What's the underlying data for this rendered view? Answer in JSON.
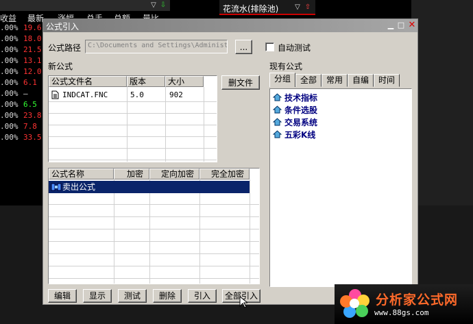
{
  "bg_table": {
    "header": [
      "收益",
      "最新",
      "涨幅",
      "总手",
      "总额",
      "量比"
    ],
    "rows": [
      {
        "a": ".00%",
        "b": "19.6",
        "c": "#ff3333"
      },
      {
        "a": ".00%",
        "b": "18.0",
        "c": "#ff3333"
      },
      {
        "a": ".00%",
        "b": "21.5",
        "c": "#ff3333"
      },
      {
        "a": ".00%",
        "b": "13.1",
        "c": "#ff3333"
      },
      {
        "a": ".00%",
        "b": "12.0",
        "c": "#ff3333"
      },
      {
        "a": ".00%",
        "b": "6.1",
        "c": "#ff3333"
      },
      {
        "a": ".00%",
        "b": "—",
        "c": "#dddddd"
      },
      {
        "a": ".00%",
        "b": "6.5",
        "c": "#33ff33"
      },
      {
        "a": ".00%",
        "b": "23.8",
        "c": "#ff3333"
      },
      {
        "a": ".00%",
        "b": "7.8",
        "c": "#ff3333"
      },
      {
        "a": ".00%",
        "b": "33.5",
        "c": "#ff3333"
      }
    ]
  },
  "bg_right": {
    "title": "花流水(排除池)"
  },
  "dialog": {
    "title": "公式引入",
    "path_label": "公式路径",
    "path_value": "C:\\Documents and Settings\\Administ",
    "browse_label": "...",
    "auto_test_label": "自动测试",
    "new_formula_label": "新公式",
    "files_table": {
      "headers": [
        "公式文件名",
        "版本",
        "大小"
      ],
      "rows": [
        {
          "name": "INDCAT.FNC",
          "version": "5.0",
          "size": "902"
        }
      ]
    },
    "delete_file_label": "删文件",
    "formulas_table": {
      "headers": [
        "公式名称",
        "加密",
        "定向加密",
        "完全加密"
      ],
      "rows": [
        {
          "name": "卖出公式",
          "enc": "",
          "dir_enc": "",
          "full_enc": ""
        }
      ]
    },
    "existing_label": "现有公式",
    "tabs": [
      "分组",
      "全部",
      "常用",
      "自编",
      "时间"
    ],
    "tree_items": [
      "技术指标",
      "条件选股",
      "交易系统",
      "五彩K线"
    ],
    "buttons": [
      "编辑",
      "显示",
      "测试",
      "删除",
      "引入",
      "全部引入"
    ]
  },
  "watermark": {
    "name": "分析家公式网",
    "url": "www.88gs.com"
  },
  "colors": {
    "selection": "#0a246a",
    "dialog_bg": "#d4d0c8",
    "tree_text": "#000080",
    "watermark": "#ff6a2a"
  }
}
